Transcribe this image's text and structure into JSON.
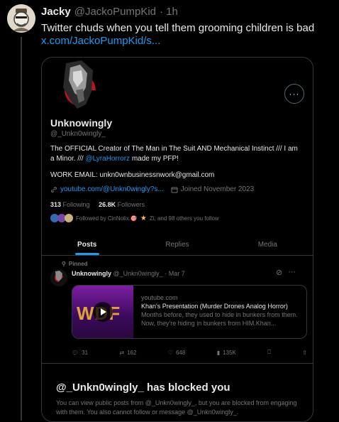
{
  "tweet": {
    "name": "Jacky",
    "handle": "@JackoPumpKid",
    "time": "· 1h",
    "text": "Twitter chuds when you tell them grooming children is bad",
    "link": "x.com/JackoPumpKid/s..."
  },
  "profile": {
    "name": "Unknowingly",
    "handle": "@_Unkn0wingly_",
    "bio_part1": "The OFFICIAL Creator of The Man in The Suit AND Mechanical Instinct /// I am a Minor. /// ",
    "bio_mention": "@LyraHorrorz",
    "bio_part2": " made my PFP!",
    "work_email": "WORK EMAIL: unkn0wnbusinessnwork@gmail.com",
    "website": "youtube.com/@Unkn0wingly?s...",
    "joined": "Joined November 2023",
    "following_count": "313",
    "following_label": "Following",
    "followers_count": "26.8K",
    "followers_label": "Followers",
    "followed_by": "Followed by CinNolix.🎯",
    "followed_by_rest": "Zi, and 98 others you follow",
    "more_label": "···"
  },
  "tabs": [
    "Posts",
    "Replies",
    "Media"
  ],
  "pinned_post": {
    "pinned_label": "Pinned",
    "name": "Unknowingly",
    "handle": "@_Unkn0wingly_",
    "time": "· Mar 7",
    "yt_source": "youtube.com",
    "yt_title": "Khan's Presentation (Murder Drones Analog Horror)",
    "yt_desc": "Months before, they used to hide in bunkers from them. Now, they're hiding in bunkers from HIM.Khan...",
    "thumb_text": "WDF",
    "replies": "31",
    "reposts": "162",
    "likes": "648",
    "views": "135K"
  },
  "blocked": {
    "title": "@_Unkn0wingly_ has blocked you",
    "body": "You can view public posts from @_Unkn0wingly_, but you are blocked from engaging with them. You also cannot follow or message @_Unkn0wingly_."
  },
  "colors": {
    "accent": "#1d9bf0",
    "muted": "#71767b",
    "border": "#333639",
    "background": "#000000"
  }
}
